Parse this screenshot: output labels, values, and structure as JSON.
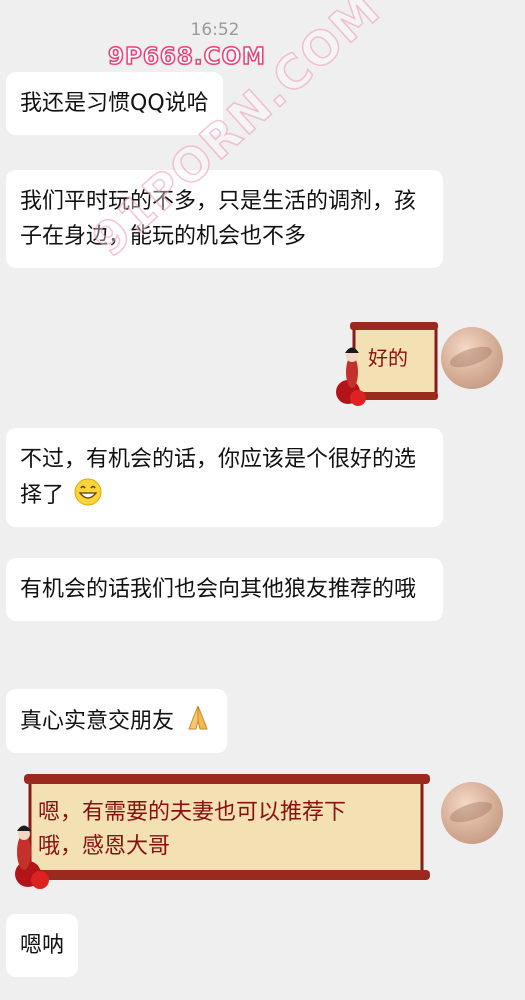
{
  "status": {
    "time": "16:52"
  },
  "watermarks": {
    "top": "9P668.COM",
    "diagonal": "91PORN.COM"
  },
  "messages": [
    {
      "text": "我还是习惯QQ说哈"
    },
    {
      "text": "我们平时玩的不多，只是生活的调剂，孩子在身边，能玩的机会也不多"
    },
    {
      "sticker_text": "好的"
    },
    {
      "text": "不过，有机会的话，你应该是个很好的选择了",
      "emoji": "grinning-face-icon"
    },
    {
      "text": "有机会的话我们也会向其他狼友推荐的哦"
    },
    {
      "text": "真心实意交朋友",
      "emoji": "folded-hands-icon"
    },
    {
      "sticker_text_line1": "嗯，有需要的夫妻也可以推荐下",
      "sticker_text_line2": "哦，感恩大哥"
    },
    {
      "text": "嗯呐"
    }
  ],
  "colors": {
    "background": "#efefef",
    "bubble": "#ffffff",
    "scroll": "#f3e1b4",
    "scroll_border": "#8b1a1a"
  }
}
